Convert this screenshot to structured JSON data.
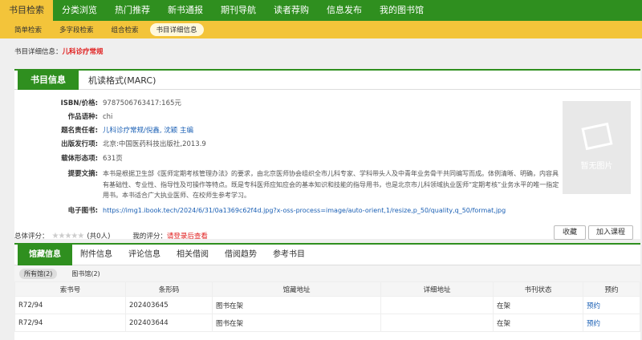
{
  "topnav": [
    "书目检索",
    "分类浏览",
    "热门推荐",
    "新书通报",
    "期刊导航",
    "读者荐购",
    "信息发布",
    "我的图书馆"
  ],
  "subnav": [
    "简单检索",
    "多字段检索",
    "组合检索",
    "书目详细信息"
  ],
  "crumb": {
    "label": "书目详细信息：",
    "title": "儿科诊疗常规"
  },
  "book": {
    "tab_title": "书目信息",
    "tab_sub": "机读格式(MARC)",
    "fields": [
      {
        "label": "ISBN/价格:",
        "value": "9787506763417:165元"
      },
      {
        "label": "作品语种:",
        "value": "chi"
      },
      {
        "label": "题名责任者:",
        "value": "儿科诊疗常规/倪鑫, 沈颖 主编"
      },
      {
        "label": "出版发行项:",
        "value": "北京:中国医药科技出版社,2013.9"
      },
      {
        "label": "载体形态项:",
        "value": "631页"
      },
      {
        "label": "提要文摘:",
        "value": "本书是根据卫生部《医师定期考核管理办法》的要求，由北京医师协会组织全市儿科专家、学科带头人及中青年业务骨干共同编写而成。体例清晰、明确，内容具有基础性、专业性、指导性及可操作等特点。既是专科医师应知应会的基本知识和技能的指导用书，也是北京市儿科领域执业医师“定期考核”业务水平的唯一指定用书。本书适合广大执业医师、在校师生参考学习。"
      },
      {
        "label": "电子图书:",
        "value": "https://img1.ibook.tech/2024/6/31/0a1369c62f4d.jpg?x-oss-process=image/auto-orient,1/resize,p_50/quality,q_50/format,jpg"
      }
    ],
    "no_image": "暂无图片"
  },
  "rating": {
    "label": "总体评分：",
    "count": "(共0人)",
    "mine": "我的评分：",
    "login": "请登录后查看"
  },
  "buttons": {
    "favorite": "收藏",
    "add_course": "加入课程"
  },
  "tabs2": [
    "馆藏信息",
    "附件信息",
    "评论信息",
    "相关借阅",
    "借阅趋势",
    "参考书目"
  ],
  "libtabs": [
    "所有馆(2)",
    "图书馆(2)"
  ],
  "table": {
    "headers": [
      "索书号",
      "条形码",
      "馆藏地址",
      "详细地址",
      "书刊状态",
      "预约"
    ],
    "rows": [
      [
        "R72/94",
        "202403645",
        "图书在架",
        "",
        "在架",
        "预约"
      ],
      [
        "R72/94",
        "202403644",
        "图书在架",
        "",
        "在架",
        "预约"
      ]
    ]
  }
}
